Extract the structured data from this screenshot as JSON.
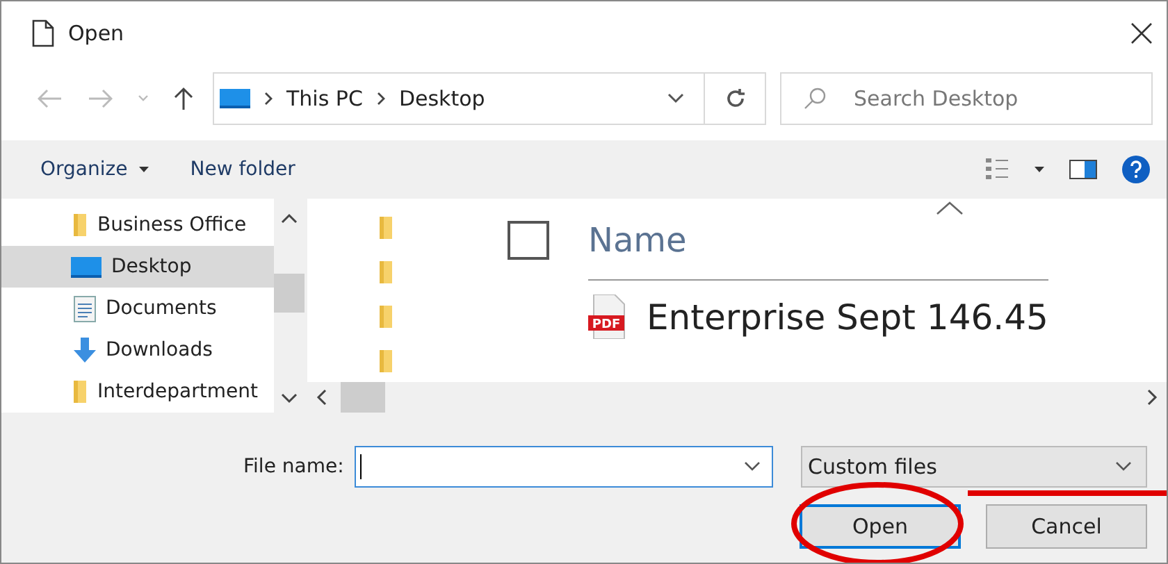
{
  "window": {
    "title": "Open"
  },
  "address": {
    "path": [
      "This PC",
      "Desktop"
    ]
  },
  "search": {
    "placeholder": "Search Desktop"
  },
  "toolbar": [
    "Organize",
    "New folder"
  ],
  "sidebar": {
    "items": [
      {
        "label": "Business Office",
        "kind": "folder",
        "selected": false
      },
      {
        "label": "Desktop",
        "kind": "desktop",
        "selected": true
      },
      {
        "label": "Documents",
        "kind": "documents",
        "selected": false
      },
      {
        "label": "Downloads",
        "kind": "downloads",
        "selected": false
      },
      {
        "label": "Interdepartment",
        "kind": "folder",
        "selected": false
      }
    ]
  },
  "file_list": {
    "column": "Name",
    "select_all_checked": false,
    "files": [
      {
        "name": "Enterprise Sept 146.45",
        "kind": "pdf",
        "badge": "PDF"
      }
    ]
  },
  "file_name": {
    "label": "File name:"
  },
  "filter": {
    "value": "Custom files"
  },
  "buttons": [
    {
      "label": "Open",
      "default": true
    },
    {
      "label": "Cancel",
      "default": false
    }
  ],
  "annotation": {
    "kind": "ellipse"
  }
}
